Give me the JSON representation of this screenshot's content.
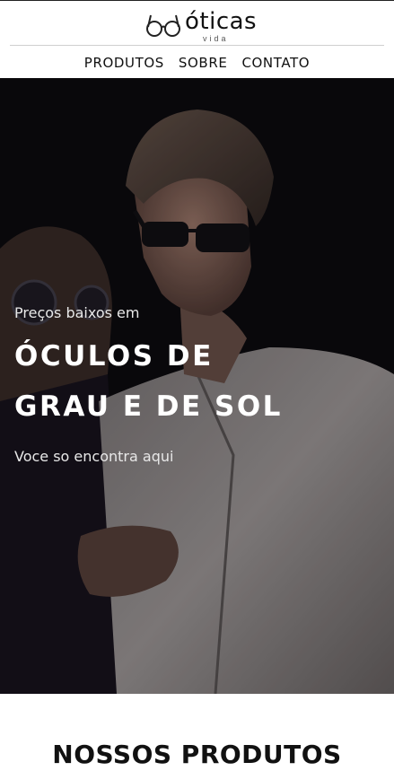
{
  "brand": {
    "name": "óticas",
    "tagline": "vida",
    "logo_icon": "glasses-icon"
  },
  "nav": {
    "items": [
      {
        "label": "PRODUTOS"
      },
      {
        "label": "SOBRE"
      },
      {
        "label": "CONTATO"
      }
    ]
  },
  "hero": {
    "kicker": "Preços baixos em",
    "title_line1": "ÓCULOS DE",
    "title_line2": "GRAU E DE SOL",
    "subtitle": "Voce so encontra aqui",
    "image_subject": "couple-wearing-sunglasses"
  },
  "products": {
    "section_title": "NOSSOS PRODUTOS"
  },
  "colors": {
    "hero_overlay": "#0b0a0d",
    "text_light": "#ffffff",
    "text_dark": "#111111"
  }
}
